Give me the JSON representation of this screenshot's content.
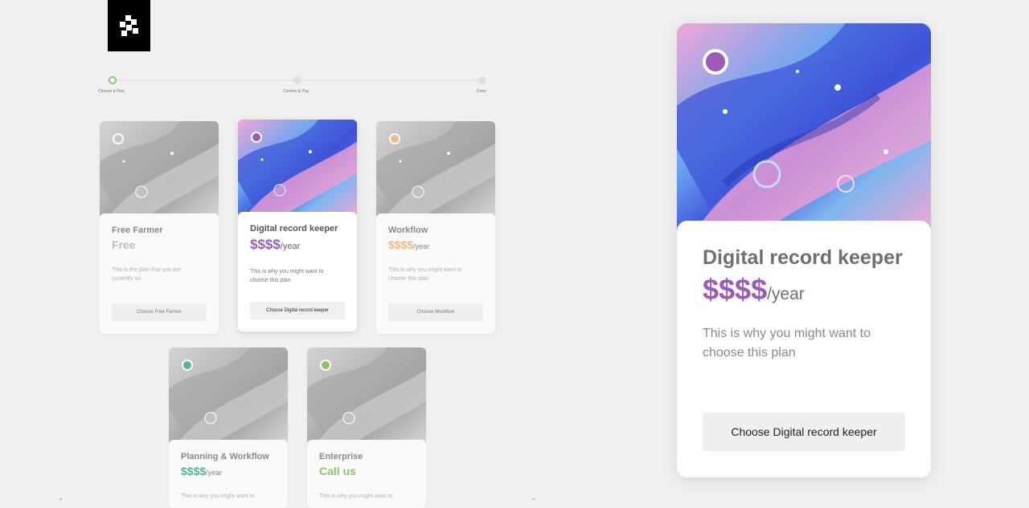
{
  "stepper": {
    "steps": [
      {
        "label": "Choose a Plan",
        "state": "active"
      },
      {
        "label": "Confirm & Pay",
        "state": "todo"
      },
      {
        "label": "Done",
        "state": "todo"
      }
    ]
  },
  "plans": [
    {
      "name": "Free Farmer",
      "price": "Free",
      "per": "",
      "desc": "This is the plan that you are currently on",
      "button": "Choose Free Farmer",
      "color": "#bdbdbd",
      "selected": false
    },
    {
      "name": "Digital record keeper",
      "price": "$$$$",
      "per": "/year",
      "desc": "This is why you might want to choose this plan",
      "button": "Choose Digital record keeper",
      "color": "#9d5ab6",
      "selected": true
    },
    {
      "name": "Workflow",
      "price": "$$$$",
      "per": "/year",
      "desc": "This is why you might want to choose this plan",
      "button": "Choose Workflow",
      "color": "#f0b98b",
      "selected": false
    },
    {
      "name": "Planning & Workflow",
      "price": "$$$$",
      "per": "/year",
      "desc": "This is why you might want to",
      "button": "",
      "color": "#58b39e",
      "selected": false
    },
    {
      "name": "Enterprise",
      "price": "Call us",
      "per": "",
      "desc": "This is why you might want to",
      "button": "",
      "color": "#8cc56a",
      "selected": false
    }
  ],
  "detail": {
    "name": "Digital record keeper",
    "price": "$$$$",
    "per": "/year",
    "desc": "This is why you might want to choose this plan",
    "button": "Choose Digital record keeper",
    "accent": "#9d5ab6"
  }
}
